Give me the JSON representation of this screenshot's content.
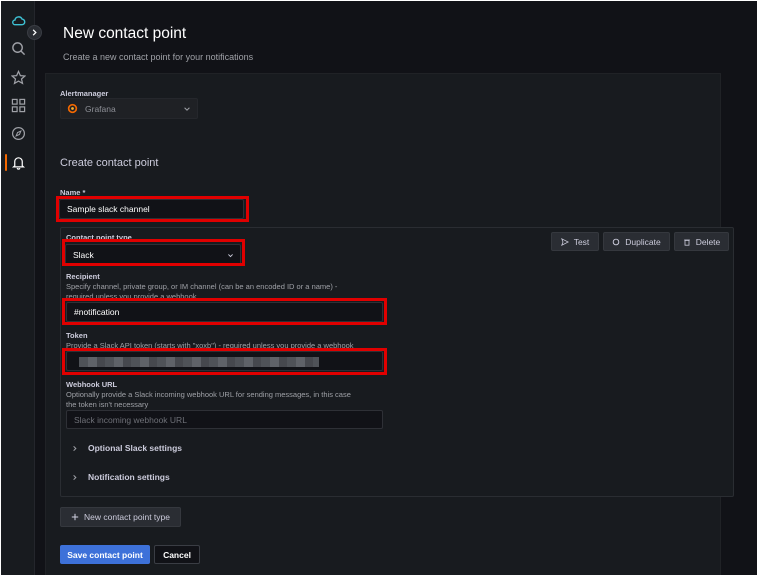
{
  "header": {
    "title": "New contact point",
    "subtitle": "Create a new contact point for your notifications"
  },
  "alertmanager": {
    "label": "Alertmanager",
    "selected": "Grafana"
  },
  "form": {
    "section_title": "Create contact point",
    "name_label": "Name *",
    "name_value": "Sample slack channel",
    "contact_point_type_label": "Contact point type",
    "contact_point_type_value": "Slack",
    "recipient_label": "Recipient",
    "recipient_desc_1": "Specify channel, private group, or IM channel (can be an encoded ID or a name) -",
    "recipient_desc_2": "required unless you provide a webhook",
    "recipient_value": "#notification",
    "token_label": "Token",
    "token_desc": "Provide a Slack API token (starts with \"xoxb\") - required unless you provide a webhook",
    "webhook_label": "Webhook URL",
    "webhook_desc_1": "Optionally provide a Slack incoming webhook URL for sending messages, in this case",
    "webhook_desc_2": "the token isn't necessary",
    "webhook_placeholder": "Slack incoming webhook URL",
    "optional_settings": "Optional Slack settings",
    "notification_settings": "Notification settings"
  },
  "actions": {
    "test": "Test",
    "duplicate": "Duplicate",
    "delete": "Delete",
    "new_type": "New contact point type",
    "save": "Save contact point",
    "cancel": "Cancel"
  },
  "colors": {
    "accent": "#f46800",
    "primary": "#3d71d9",
    "highlight": "#e00000",
    "background": "#111217"
  },
  "icons": {
    "sidebar": [
      "cloud-icon",
      "search-icon",
      "star-icon",
      "dashboards-icon",
      "explore-icon",
      "bell-icon"
    ]
  }
}
